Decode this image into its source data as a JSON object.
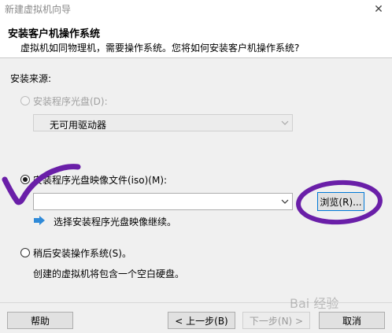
{
  "window": {
    "title": "新建虚拟机向导"
  },
  "header": {
    "title": "安装客户机操作系统",
    "description": "虚拟机如同物理机，需要操作系统。您将如何安装客户机操作系统?"
  },
  "install_source": {
    "label": "安装来源:",
    "disc_option": {
      "label": "安装程序光盘(D):",
      "selected": false,
      "enabled": false,
      "drive_value": "无可用驱动器"
    },
    "iso_option": {
      "label": "安装程序光盘映像文件(iso)(M):",
      "selected": true,
      "path_value": "",
      "browse_label": "浏览(R)...",
      "hint": "选择安装程序光盘映像继续。"
    },
    "later_option": {
      "label": "稍后安装操作系统(S)。",
      "selected": false,
      "description": "创建的虚拟机将包含一个空白硬盘。"
    }
  },
  "footer": {
    "help_label": "帮助",
    "back_label": "< 上一步(B)",
    "next_label": "下一步(N) >",
    "cancel_label": "取消"
  },
  "watermark": "Bai 经验",
  "colors": {
    "annotation_purple": "#6a1fa8",
    "info_arrow_blue": "#2f8ad8",
    "accent": "#0078d7"
  },
  "icons": {
    "close": "close-icon",
    "dropdown": "chevron-down-icon",
    "info": "right-arrow-info-icon"
  }
}
